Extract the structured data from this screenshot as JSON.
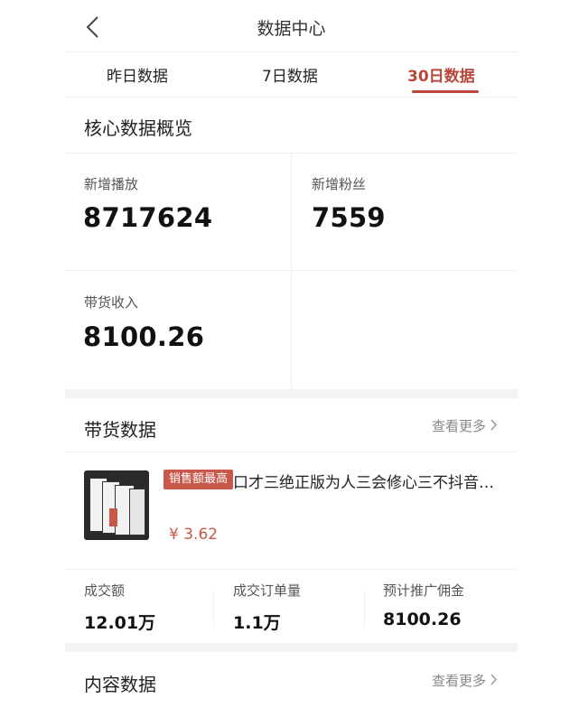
{
  "header": {
    "title": "数据中心"
  },
  "tabs": [
    {
      "label": "昨日数据"
    },
    {
      "label": "7日数据"
    },
    {
      "label": "30日数据",
      "active": true
    }
  ],
  "overview": {
    "title": "核心数据概览",
    "stats": [
      {
        "label": "新增播放",
        "value": "8717624"
      },
      {
        "label": "新增粉丝",
        "value": "7559"
      },
      {
        "label": "带货收入",
        "value": "8100.26"
      }
    ]
  },
  "sales": {
    "title": "带货数据",
    "more": "查看更多",
    "product": {
      "badge": "销售额最高",
      "title": "口才三绝正版为人三会修心三不抖音…",
      "price": "¥ 3.62"
    },
    "metrics": [
      {
        "label": "成交额",
        "value": "12.01万"
      },
      {
        "label": "成交订单量",
        "value": "1.1万"
      },
      {
        "label": "预计推广佣金",
        "value": "8100.26"
      }
    ]
  },
  "content": {
    "title": "内容数据",
    "more": "查看更多"
  },
  "colors": {
    "accent": "#b8473a",
    "badge": "#c9574a"
  }
}
